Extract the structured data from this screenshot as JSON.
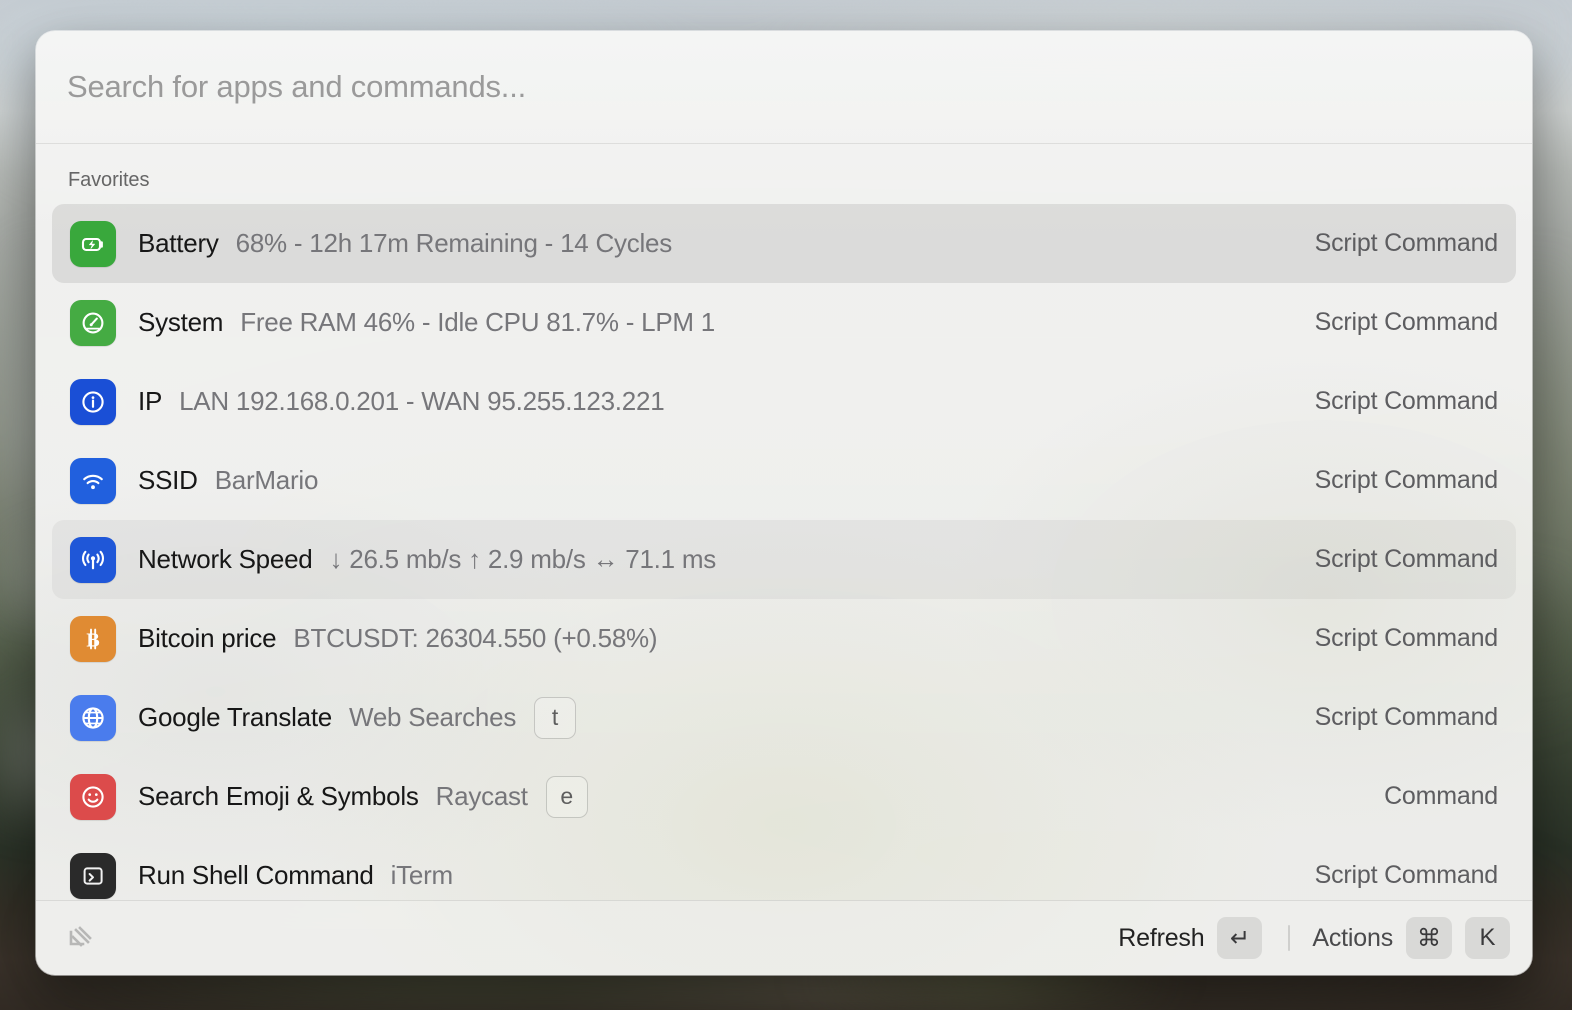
{
  "window": {
    "search": {
      "placeholder": "Search for apps and commands...",
      "value": ""
    },
    "section_title": "Favorites",
    "rows": [
      {
        "title": "Battery",
        "subtitle": "68% - 12h 17m Remaining - 14 Cycles",
        "alias": "",
        "accessory": "Script Command",
        "icon": "battery-bolt-icon",
        "icon_color": "#39a83c",
        "state": "selected"
      },
      {
        "title": "System",
        "subtitle": "Free RAM 46% - Idle CPU 81.7% - LPM 1",
        "alias": "",
        "accessory": "Script Command",
        "icon": "gauge-icon",
        "icon_color": "#45ab43",
        "state": "normal"
      },
      {
        "title": "IP",
        "subtitle": "LAN 192.168.0.201 - WAN 95.255.123.221",
        "alias": "",
        "accessory": "Script Command",
        "icon": "info-circle-icon",
        "icon_color": "#1a4fd6",
        "state": "normal"
      },
      {
        "title": "SSID",
        "subtitle": "BarMario",
        "alias": "",
        "accessory": "Script Command",
        "icon": "wifi-icon",
        "icon_color": "#2160de",
        "state": "normal"
      },
      {
        "title": "Network Speed",
        "subtitle": "↓ 26.5 mb/s  ↑ 2.9 mb/s  ↔ 71.1 ms",
        "alias": "",
        "accessory": "Script Command",
        "icon": "antenna-broadcast-icon",
        "icon_color": "#1f57d8",
        "state": "hover"
      },
      {
        "title": "Bitcoin price",
        "subtitle": "BTCUSDT: 26304.550 (+0.58%)",
        "alias": "",
        "accessory": "Script Command",
        "icon": "bitcoin-icon",
        "icon_color": "#e08b33",
        "state": "normal"
      },
      {
        "title": "Google Translate",
        "subtitle": "Web Searches",
        "alias": "t",
        "accessory": "Script Command",
        "icon": "globe-icon",
        "icon_color": "#4a7ced",
        "state": "normal"
      },
      {
        "title": "Search Emoji & Symbols",
        "subtitle": "Raycast",
        "alias": "e",
        "accessory": "Command",
        "icon": "smiley-face-icon",
        "icon_color": "#dc4b4b",
        "state": "normal"
      },
      {
        "title": "Run Shell Command",
        "subtitle": "iTerm",
        "alias": "",
        "accessory": "Script Command",
        "icon": "terminal-icon",
        "icon_color": "#2a2a2a",
        "state": "normal"
      }
    ],
    "footer": {
      "logo": "raycast-logo",
      "primary_action": "Refresh",
      "primary_key": "↵",
      "actions_label": "Actions",
      "actions_key_cmd": "⌘",
      "actions_key_letter": "K"
    }
  }
}
